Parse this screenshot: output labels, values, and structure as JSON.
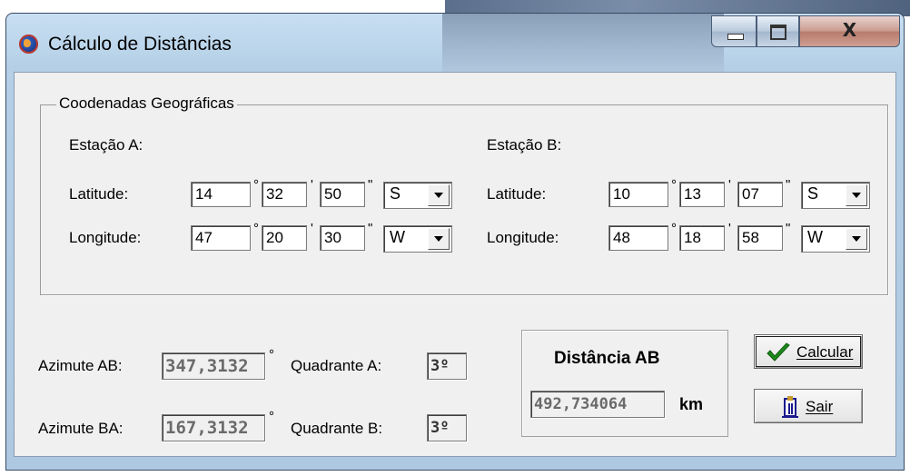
{
  "window": {
    "title": "Cálculo de Distâncias",
    "close_glyph": "X"
  },
  "group": {
    "legend": "Coodenadas Geográficas",
    "station_a": {
      "heading": "Estação A:",
      "latitude_label": "Latitude:",
      "longitude_label": "Longitude:",
      "latitude": {
        "deg": "14",
        "min": "32",
        "sec": "50",
        "hemisphere": "S"
      },
      "longitude": {
        "deg": "47",
        "min": "20",
        "sec": "30",
        "hemisphere": "W"
      }
    },
    "station_b": {
      "heading": "Estação B:",
      "latitude_label": "Latitude:",
      "longitude_label": "Longitude:",
      "latitude": {
        "deg": "10",
        "min": "13",
        "sec": "07",
        "hemisphere": "S"
      },
      "longitude": {
        "deg": "48",
        "min": "18",
        "sec": "58",
        "hemisphere": "W"
      }
    }
  },
  "symbols": {
    "degree": "°",
    "minute": "'",
    "second": "\""
  },
  "results": {
    "azimute_ab_label": "Azimute AB:",
    "azimute_ab": "347,3132",
    "azimute_ba_label": "Azimute BA:",
    "azimute_ba": "167,3132",
    "quadrante_a_label": "Quadrante A:",
    "quadrante_a": "3º",
    "quadrante_b_label": "Quadrante B:",
    "quadrante_b": "3º",
    "distance_title": "Distância AB",
    "distance_value": "492,734064",
    "distance_unit": "km"
  },
  "buttons": {
    "calcular": "Calcular",
    "sair": "Sair"
  }
}
